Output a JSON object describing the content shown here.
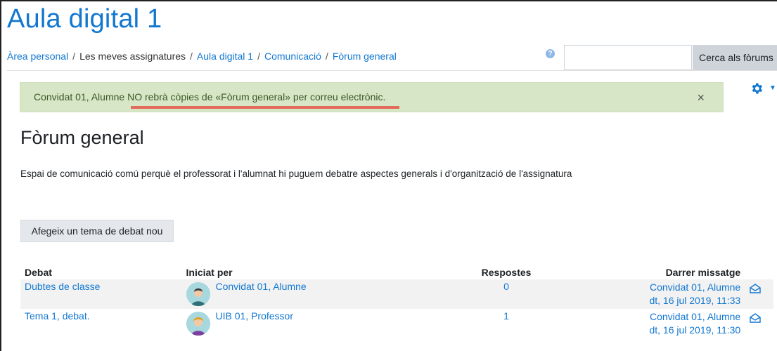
{
  "site": {
    "title": "Aula digital 1"
  },
  "breadcrumb": {
    "items": [
      "Àrea personal",
      "Les meves assignatures",
      "Aula digital 1",
      "Comunicació",
      "Fòrum general"
    ]
  },
  "search": {
    "button_label": "Cerca als fòrums",
    "value": ""
  },
  "alert": {
    "prefix": "Convidat 01, Alumne ",
    "message": "NO rebrà còpies de «Fòrum general» per correu electrònic.",
    "close": "×"
  },
  "page": {
    "title": "Fòrum general",
    "intro": "Espai de comunicació comú perquè el professorat i l'alumnat hi puguem debatre aspectes generals i d'organització de l'assignatura",
    "add_button": "Afegeix un tema de debat nou"
  },
  "table": {
    "headers": {
      "debat": "Debat",
      "iniciat": "Iniciat per",
      "respostes": "Respostes",
      "darrer": "Darrer missatge"
    },
    "rows": [
      {
        "debat": "Dubtes de classe",
        "iniciat": "Convidat 01, Alumne",
        "respostes": "0",
        "darrer_user": "Convidat 01, Alumne",
        "darrer_date": "dt, 16 jul 2019, 11:33"
      },
      {
        "debat": "Tema 1, debat.",
        "iniciat": "UIB 01, Professor",
        "respostes": "1",
        "darrer_user": "Convidat 01, Alumne",
        "darrer_date": "dt, 16 jul 2019, 11:30"
      }
    ]
  },
  "colors": {
    "accent": "#1177d1",
    "alert_bg": "#d7e6c6",
    "underline": "#e26b5b"
  },
  "icons": {
    "help": "question-circle-icon",
    "settings": "gear-icon",
    "subscribe": "envelope-open-icon"
  }
}
